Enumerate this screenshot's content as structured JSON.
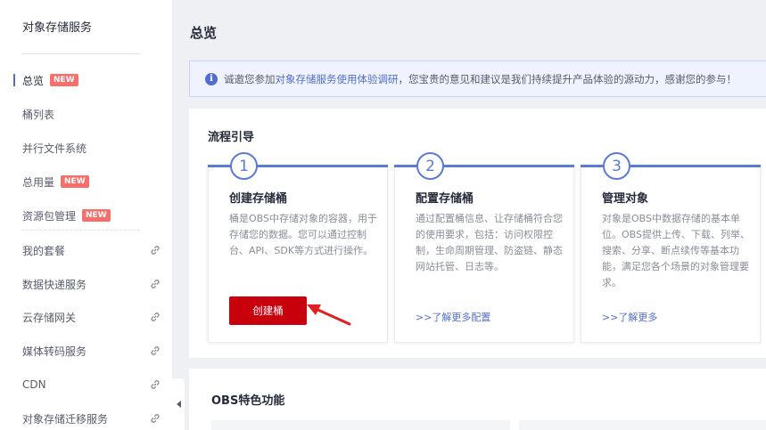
{
  "sidebar": {
    "title": "对象存储服务",
    "items": [
      {
        "label": "总览",
        "badge": "NEW"
      },
      {
        "label": "桶列表"
      },
      {
        "label": "并行文件系统"
      },
      {
        "label": "总用量",
        "badge": "NEW"
      },
      {
        "label": "资源包管理",
        "badge": "NEW"
      },
      {
        "label": "我的套餐",
        "icon": "link-icon"
      },
      {
        "label": "数据快递服务",
        "icon": "link-icon"
      },
      {
        "label": "云存储网关",
        "icon": "link-icon"
      },
      {
        "label": "媒体转码服务",
        "icon": "link-icon"
      },
      {
        "label": "CDN",
        "icon": "link-icon"
      },
      {
        "label": "对象存储迁移服务",
        "icon": "link-icon"
      }
    ]
  },
  "page": {
    "title": "总览"
  },
  "notice": {
    "icon": "info-icon",
    "prefix": "诚邀您参加",
    "link": "对象存储服务使用体验调研",
    "suffix": "，您宝贵的意见和建议是我们持续提升产品体验的源动力，感谢您的参与！"
  },
  "guide": {
    "title": "流程引导",
    "steps": [
      {
        "num": "1",
        "heading": "创建存储桶",
        "desc": "桶是OBS中存储对象的容器，用于存储您的数据。您可以通过控制台、API、SDK等方式进行操作。",
        "button": "创建桶"
      },
      {
        "num": "2",
        "heading": "配置存储桶",
        "desc": "通过配置桶信息、让存储桶符合您的使用要求，包括：访问权限控制，生命周期管理、防盗链、静态网站托管、日志等。",
        "link": ">>了解更多配置"
      },
      {
        "num": "3",
        "heading": "管理对象",
        "desc": "对象是OBS中数据存储的基本单位。OBS提供上传、下载、列举、搜索、分享、断点续传等基本功能，满足您各个场景的对象管理要求。",
        "link": ">>了解更多"
      }
    ]
  },
  "features": {
    "title": "OBS特色功能"
  },
  "colors": {
    "accent": "#526ecc",
    "step_blue": "#5b7bd4",
    "primary_button": "#c7000b",
    "badge": "#f66f6a",
    "annotation_arrow": "#e02020"
  }
}
